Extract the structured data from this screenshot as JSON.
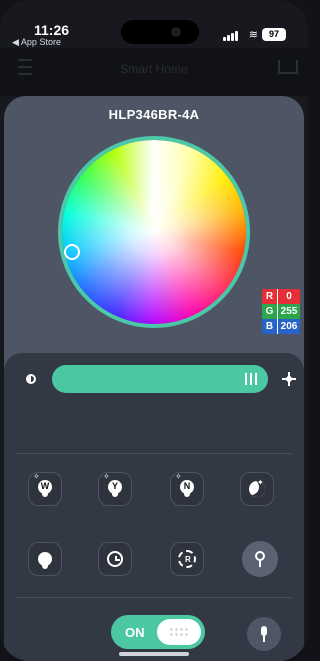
{
  "status": {
    "time": "11:26",
    "back": "◀ App Store",
    "battery": "97"
  },
  "header": {
    "title": "Smart Home"
  },
  "device": {
    "name": "HLP346BR-4A"
  },
  "color": {
    "r_label": "R",
    "r_value": "0",
    "g_label": "G",
    "g_value": "255",
    "b_label": "B",
    "b_value": "206",
    "selected_hex": "#00ffce"
  },
  "controls": {
    "brightness_level": 0.95,
    "toggle_label": "ON",
    "bulb_w": "W",
    "bulb_y": "Y",
    "bulb_n": "N",
    "refresh_letter": "R"
  },
  "colors": {
    "accent": "#4bc7a2",
    "panel": "#333944",
    "sheet": "#4e5666",
    "background": "#17191e"
  }
}
